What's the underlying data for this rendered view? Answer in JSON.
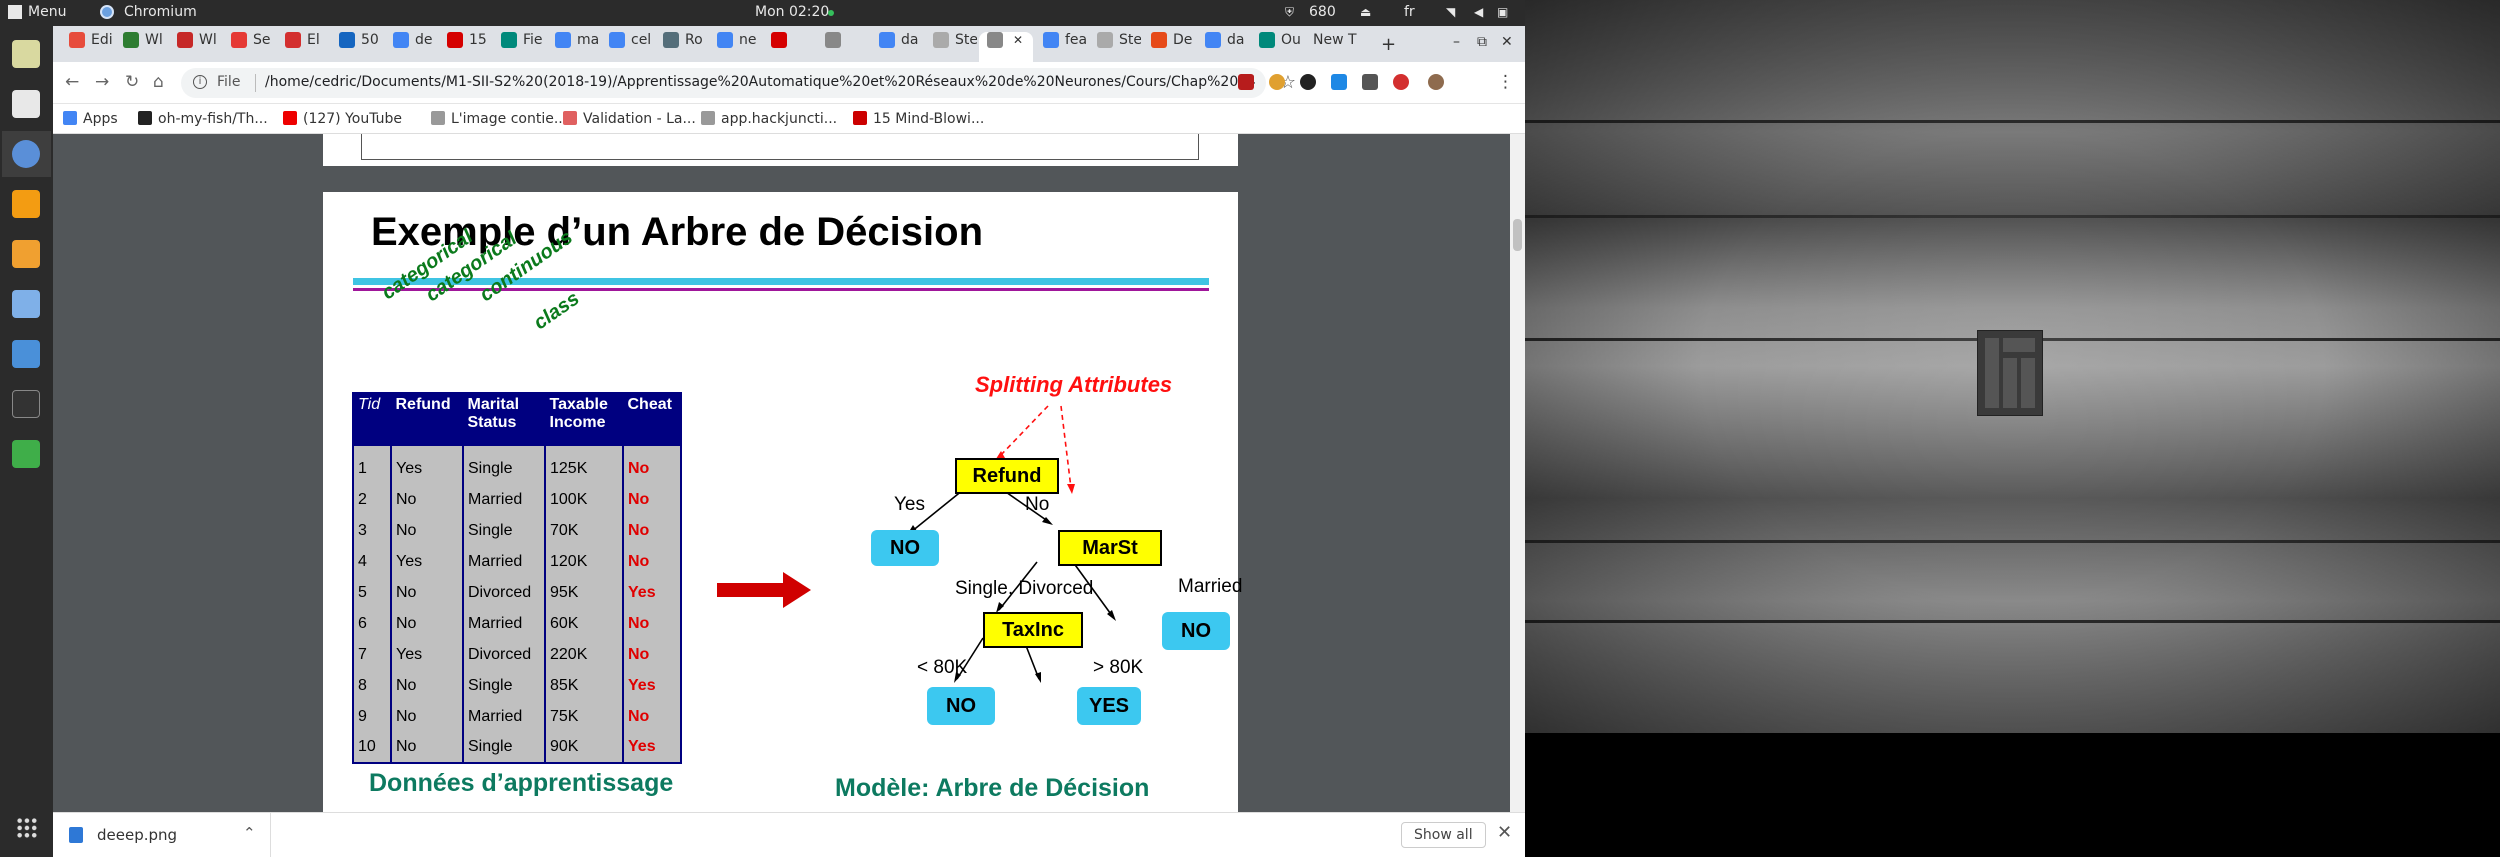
{
  "system_panel": {
    "menu_label": "Menu",
    "app_name": "Chromium",
    "clock": "Mon 02:20",
    "battery": "680",
    "keyboard_layout": "fr"
  },
  "browser": {
    "tabs": [
      {
        "label": "Edi",
        "color": "#e74c3c"
      },
      {
        "label": "Wl",
        "color": "#2e7d32"
      },
      {
        "label": "Wl",
        "color": "#c62828"
      },
      {
        "label": "Se",
        "color": "#e53935"
      },
      {
        "label": "El",
        "color": "#d32f2f"
      },
      {
        "label": "50",
        "color": "#1565c0"
      },
      {
        "label": "de",
        "color": "#4285f4"
      },
      {
        "label": "15",
        "color": "#d50000"
      },
      {
        "label": "Fie",
        "color": "#00897b"
      },
      {
        "label": "ma",
        "color": "#4285f4"
      },
      {
        "label": "cel",
        "color": "#4285f4"
      },
      {
        "label": "Ro",
        "color": "#546e7a"
      },
      {
        "label": "ne",
        "color": "#4285f4"
      },
      {
        "label": "",
        "color": "#d50000"
      },
      {
        "label": "",
        "color": "#888888"
      },
      {
        "label": "da",
        "color": "#4285f4"
      },
      {
        "label": "Ste",
        "color": "#aaaaaa"
      },
      {
        "label": "",
        "color": "#888888",
        "active": true
      },
      {
        "label": "fea",
        "color": "#4285f4"
      },
      {
        "label": "Ste",
        "color": "#aaaaaa"
      },
      {
        "label": "De",
        "color": "#e64a19"
      },
      {
        "label": "da",
        "color": "#4285f4"
      },
      {
        "label": "Ou",
        "color": "#00897b"
      },
      {
        "label": "New T",
        "color": ""
      }
    ],
    "address": {
      "scheme_label": "File",
      "url": "/home/cedric/Documents/M1-SII-S2%20(2018-19)/Apprentissage%20Automatique%20et%20Réseaux%20de%20Neurones/Cours/Chap%2004%2..."
    },
    "bookmarks": [
      {
        "label": "Apps",
        "icon": "apps-grid-icon"
      },
      {
        "label": "oh-my-fish/Th...",
        "icon": "github-icon"
      },
      {
        "label": "(127) YouTube",
        "icon": "youtube-icon"
      },
      {
        "label": "L'image contie...",
        "icon": "page-icon"
      },
      {
        "label": "Validation - La...",
        "icon": "validation-icon"
      },
      {
        "label": "app.hackjuncti...",
        "icon": "page-icon"
      },
      {
        "label": "15 Mind-Blowi...",
        "icon": "bookmark-red-icon"
      }
    ],
    "downloads": {
      "filename": "deeep.png",
      "show_all": "Show all"
    }
  },
  "slide": {
    "title": "Exemple d’un Arbre de Décision",
    "column_types": [
      "categorical",
      "categorical",
      "continuous",
      "class"
    ],
    "table": {
      "headers": [
        "Tid",
        "Refund",
        "Marital Status",
        "Taxable Income",
        "Cheat"
      ],
      "rows": [
        [
          "1",
          "Yes",
          "Single",
          "125K",
          "No"
        ],
        [
          "2",
          "No",
          "Married",
          "100K",
          "No"
        ],
        [
          "3",
          "No",
          "Single",
          "70K",
          "No"
        ],
        [
          "4",
          "Yes",
          "Married",
          "120K",
          "No"
        ],
        [
          "5",
          "No",
          "Divorced",
          "95K",
          "Yes"
        ],
        [
          "6",
          "No",
          "Married",
          "60K",
          "No"
        ],
        [
          "7",
          "Yes",
          "Divorced",
          "220K",
          "No"
        ],
        [
          "8",
          "No",
          "Single",
          "85K",
          "Yes"
        ],
        [
          "9",
          "No",
          "Married",
          "75K",
          "No"
        ],
        [
          "10",
          "No",
          "Single",
          "90K",
          "Yes"
        ]
      ]
    },
    "tree": {
      "splitting_attributes_label": "Splitting Attributes",
      "nodes": {
        "refund": "Refund",
        "marst": "MarSt",
        "taxinc": "TaxInc",
        "leaf_refund_yes": "NO",
        "leaf_married": "NO",
        "leaf_low_income": "NO",
        "leaf_high_income": "YES"
      },
      "edges": {
        "refund_yes": "Yes",
        "refund_no": "No",
        "marst_single_divorced": "Single, Divorced",
        "marst_married": "Married",
        "income_low": "< 80K",
        "income_high": "> 80K"
      }
    },
    "captions": {
      "left": "Données d’apprentissage",
      "right": "Modèle:  Arbre de Décision"
    }
  }
}
